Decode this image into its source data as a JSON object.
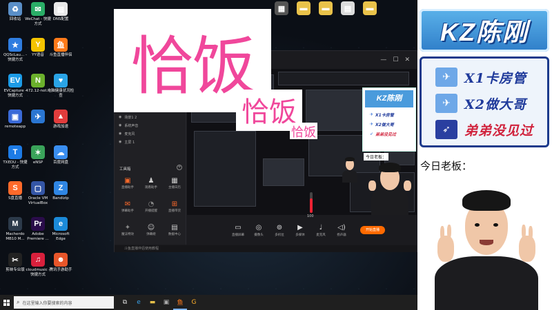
{
  "overlay": {
    "big_title": "恰饭",
    "echo_title": "恰饭"
  },
  "banner": {
    "logo_text": "KZ陈刚",
    "rules": [
      {
        "label": "X1卡房管",
        "color": "#1f3a9b",
        "icon": "jet-icon"
      },
      {
        "label": "X2做大哥",
        "color": "#1f3a9b",
        "icon": "jet-icon"
      },
      {
        "label": "弟弟没见过",
        "color": "#d0223c",
        "icon": "rocket-icon"
      }
    ],
    "boss_label": "今日老板：",
    "colors": {
      "logo_blue": "#2f7ec9",
      "rule_blue": "#1f3a9b",
      "rule_red": "#d0223c",
      "title_pink": "#f0479b"
    }
  },
  "desktop": {
    "icons": [
      {
        "label": "回收站",
        "icon": "recycle-bin-icon"
      },
      {
        "label": "WeChat - 快捷方式",
        "icon": "wechat-icon"
      },
      {
        "label": "DNS配置",
        "icon": "file-icon"
      },
      {
        "label": "QQScLau... - 快捷方式",
        "icon": "star-app-icon"
      },
      {
        "label": "YY语音",
        "icon": "yy-icon"
      },
      {
        "label": "斗鱼直播伴侣",
        "icon": "douyu-icon"
      },
      {
        "label": "EVCapture - 快捷方式",
        "icon": "ev-capture-icon"
      },
      {
        "label": "472.12-not...",
        "icon": "nvidia-icon"
      },
      {
        "label": "电脑健康状况检查",
        "icon": "health-check-icon"
      },
      {
        "label": "remoteapp",
        "icon": "remote-icon"
      },
      {
        "label": "",
        "icon": "bird-icon"
      },
      {
        "label": "游戏加速",
        "icon": "game-accel-icon"
      },
      {
        "label": "TXEDU - 快捷方式",
        "icon": "txedu-icon"
      },
      {
        "label": "eNSP",
        "icon": "ensp-icon"
      },
      {
        "label": "百度网盘",
        "icon": "baidu-pan-icon"
      },
      {
        "label": "S盘直播",
        "icon": "s-live-icon"
      },
      {
        "label": "Oracle VM VirtualBox",
        "icon": "virtualbox-icon"
      },
      {
        "label": "Bandizip",
        "icon": "bandizip-icon"
      },
      {
        "label": "Macherdo MB10 M...",
        "icon": "macherdo-icon"
      },
      {
        "label": "Adobe Premiere ...",
        "icon": "premiere-icon"
      },
      {
        "label": "Microsoft Edge",
        "icon": "edge-icon"
      },
      {
        "label": "剪映专业版",
        "icon": "jianying-icon"
      },
      {
        "label": "cloudmusic - 快捷方式",
        "icon": "cloudmusic-icon"
      },
      {
        "label": "腾讯手游助手",
        "icon": "tencent-games-icon"
      }
    ],
    "top_icons": [
      {
        "label": "",
        "icon": "app-icon"
      },
      {
        "label": "",
        "icon": "folder-icon"
      },
      {
        "label": "",
        "icon": "folder-icon"
      },
      {
        "label": "",
        "icon": "card-icon"
      },
      {
        "label": "",
        "icon": "folder-icon"
      }
    ]
  },
  "taskbar": {
    "search_placeholder": "在这里输入你要搜索的内容",
    "apps": [
      "task-view-icon",
      "edge-icon",
      "explorer-icon",
      "store-icon",
      "live-app-icon",
      "browser-icon"
    ]
  },
  "app": {
    "scenes": [
      "场景1 2",
      "系统声音",
      "麦克风",
      "主屏 1"
    ],
    "tools_title": "工具箱",
    "tools": [
      {
        "label": "直播助手",
        "icon": "assistant-icon",
        "color": "#ff6a2a"
      },
      {
        "label": "观看助手",
        "icon": "viewer-icon",
        "color": "#ccc"
      },
      {
        "label": "主播日历",
        "icon": "calendar-icon",
        "color": "#ccc"
      },
      {
        "label": "弹幕助手",
        "icon": "danmu-icon",
        "color": "#ff6a2a"
      },
      {
        "label": "开播提醒",
        "icon": "remind-icon",
        "color": "#888"
      },
      {
        "label": "直播带货",
        "icon": "shop-icon",
        "color": "#ff6a2a"
      },
      {
        "label": "魔法特效",
        "icon": "magic-icon",
        "color": "#888"
      },
      {
        "label": "弹幕姬",
        "icon": "danmu-ji-icon",
        "color": "#ccc"
      },
      {
        "label": "数据中心",
        "icon": "data-icon",
        "color": "#ccc"
      }
    ],
    "controls": [
      {
        "label": "直播屏幕",
        "icon": "screen-icon"
      },
      {
        "label": "摄像头",
        "icon": "camera-icon"
      },
      {
        "label": "多机位",
        "icon": "multi-cam-icon"
      },
      {
        "label": "多媒体",
        "icon": "media-icon"
      },
      {
        "label": "麦克风",
        "icon": "mic-icon"
      },
      {
        "label": "扬声器",
        "icon": "speaker-icon"
      }
    ],
    "live_button": "开始直播",
    "volume_value": "100",
    "volume_fraction": 0.7,
    "bottom_status": "斗鱼直播伴侣使用教程"
  }
}
